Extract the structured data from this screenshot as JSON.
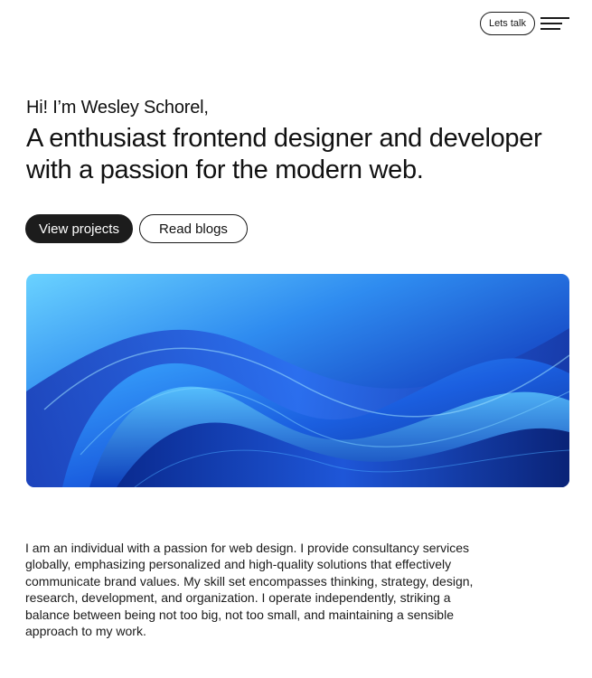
{
  "header": {
    "cta_label": "Lets talk",
    "menu_icon": "hamburger-menu-icon"
  },
  "hero": {
    "greeting": "Hi! I’m Wesley Schorel,",
    "headline": "A enthusiast frontend designer and developer with a passion for the modern web.",
    "buttons": {
      "primary_label": "View projects",
      "secondary_label": "Read blogs"
    },
    "image": {
      "description_icon": "abstract-blue-waves-image",
      "colors": {
        "light": "#6ad2ff",
        "mid": "#1f6fe6",
        "deep": "#0a2fa3",
        "dark": "#071a5e"
      }
    }
  },
  "about": {
    "text": "I am an individual with a passion for web design. I provide consultancy services globally, emphasizing personalized and high-quality solutions that effectively communicate brand values. My skill set encompasses thinking, strategy, design, research, development, and organization. I operate independently, striking a balance between being not too big, not too small, and maintaining a sensible approach to my work."
  },
  "theme": {
    "background": "#ffffff",
    "text": "#111111",
    "button_dark": "#1c1c1c"
  }
}
